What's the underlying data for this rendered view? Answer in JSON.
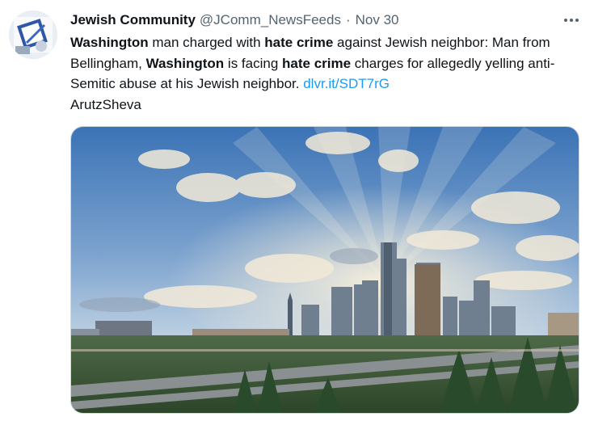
{
  "tweet": {
    "author_name": "Jewish Community",
    "handle": "@JComm_NewsFeeds",
    "separator": "·",
    "date": "Nov 30",
    "more_icon": "more-horizontal-icon",
    "text": {
      "bold_1": "Washington",
      "plain_1": " man charged with ",
      "bold_2": "hate crime",
      "plain_2": " against Jewish neighbor: Man from Bellingham, ",
      "bold_3": "Washington",
      "plain_3": " is facing ",
      "bold_4": "hate crime",
      "plain_4": " charges for allegedly yelling anti-Semitic abuse at his Jewish neighbor. ",
      "link": "dlvr.it/SDT7rG",
      "source": "ArutzSheva"
    },
    "media": {
      "alt": "Seattle skyline"
    }
  },
  "colors": {
    "text": "#0f1419",
    "muted": "#536471",
    "link": "#1d9bf0",
    "sky_top": "#3e76b8",
    "sky_bottom": "#c9d8e6"
  }
}
